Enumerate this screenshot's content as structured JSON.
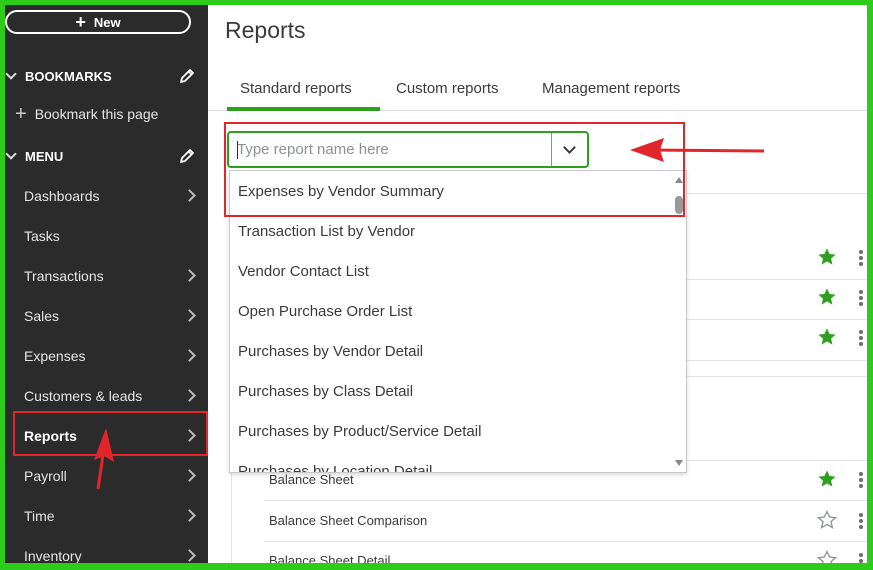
{
  "sidebar": {
    "new_label": "New",
    "bookmarks_label": "BOOKMARKS",
    "bookmark_this_page": "Bookmark this page",
    "menu_label": "MENU",
    "items": [
      {
        "label": "Dashboards"
      },
      {
        "label": "Tasks"
      },
      {
        "label": "Transactions"
      },
      {
        "label": "Sales"
      },
      {
        "label": "Expenses"
      },
      {
        "label": "Customers & leads"
      },
      {
        "label": "Reports"
      },
      {
        "label": "Payroll"
      },
      {
        "label": "Time"
      },
      {
        "label": "Inventory"
      }
    ],
    "active_item": "Reports"
  },
  "main": {
    "title": "Reports",
    "tabs": [
      {
        "label": "Standard reports"
      },
      {
        "label": "Custom reports"
      },
      {
        "label": "Management reports"
      }
    ],
    "active_tab": "Standard reports",
    "search": {
      "placeholder": "Type report name here",
      "value": ""
    },
    "dropdown_options": [
      "Expenses by Vendor Summary",
      "Transaction List by Vendor",
      "Vendor Contact List",
      "Open Purchase Order List",
      "Purchases by Vendor Detail",
      "Purchases by Class Detail",
      "Purchases by Product/Service Detail",
      "Purchases by Location Detail"
    ],
    "reports": [
      {
        "name": "Balance Sheet",
        "favorite": true
      },
      {
        "name": "Balance Sheet Comparison",
        "favorite": false
      },
      {
        "name": "Balance Sheet Detail",
        "favorite": false
      }
    ]
  },
  "colors": {
    "brand_green": "#2ca01c",
    "annotation_red": "#e0262b",
    "sidebar_bg": "#2b2b2b",
    "frame_green": "#2ecc1a"
  }
}
